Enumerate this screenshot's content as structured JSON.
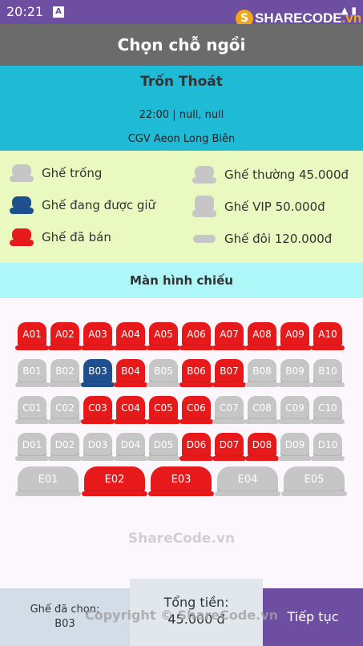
{
  "status": {
    "time": "20:21"
  },
  "logo": {
    "text_a": "SHARECODE",
    "text_b": ".vn"
  },
  "app_bar": {
    "title": "Chọn chỗ ngồi"
  },
  "movie": {
    "title": "Trốn Thoát",
    "time": "22:00 | null, null",
    "cinema": "CGV Aeon Long Biên"
  },
  "legend": {
    "empty": "Ghế trống",
    "held": "Ghế đang được giữ",
    "sold": "Ghế đã bán",
    "regular": "Ghế thường 45.000đ",
    "vip": "Ghế VIP 50.000đ",
    "couple": "Ghế đôi 120.000đ"
  },
  "screen_label": "Màn hình chiếu",
  "colors": {
    "sold": "#e8191a",
    "held": "#1e4f8e",
    "empty": "#c6c6c6",
    "accent": "#6d4ea0"
  },
  "seats": [
    [
      {
        "id": "A01",
        "state": "sold"
      },
      {
        "id": "A02",
        "state": "sold"
      },
      {
        "id": "A03",
        "state": "sold"
      },
      {
        "id": "A04",
        "state": "sold"
      },
      {
        "id": "A05",
        "state": "sold"
      },
      {
        "id": "A06",
        "state": "sold"
      },
      {
        "id": "A07",
        "state": "sold"
      },
      {
        "id": "A08",
        "state": "sold"
      },
      {
        "id": "A09",
        "state": "sold"
      },
      {
        "id": "A10",
        "state": "sold"
      }
    ],
    [
      {
        "id": "B01",
        "state": "empty"
      },
      {
        "id": "B02",
        "state": "empty"
      },
      {
        "id": "B03",
        "state": "held"
      },
      {
        "id": "B04",
        "state": "sold"
      },
      {
        "id": "B05",
        "state": "empty"
      },
      {
        "id": "B06",
        "state": "sold"
      },
      {
        "id": "B07",
        "state": "sold"
      },
      {
        "id": "B08",
        "state": "empty"
      },
      {
        "id": "B09",
        "state": "empty"
      },
      {
        "id": "B10",
        "state": "empty"
      }
    ],
    [
      {
        "id": "C01",
        "state": "empty"
      },
      {
        "id": "C02",
        "state": "empty"
      },
      {
        "id": "C03",
        "state": "sold"
      },
      {
        "id": "C04",
        "state": "sold"
      },
      {
        "id": "C05",
        "state": "sold"
      },
      {
        "id": "C06",
        "state": "sold"
      },
      {
        "id": "C07",
        "state": "empty"
      },
      {
        "id": "C08",
        "state": "empty"
      },
      {
        "id": "C09",
        "state": "empty"
      },
      {
        "id": "C10",
        "state": "empty"
      }
    ],
    [
      {
        "id": "D01",
        "state": "empty"
      },
      {
        "id": "D02",
        "state": "empty"
      },
      {
        "id": "D03",
        "state": "empty"
      },
      {
        "id": "D04",
        "state": "empty"
      },
      {
        "id": "D05",
        "state": "empty"
      },
      {
        "id": "D06",
        "state": "sold"
      },
      {
        "id": "D07",
        "state": "sold"
      },
      {
        "id": "D08",
        "state": "sold"
      },
      {
        "id": "D09",
        "state": "empty"
      },
      {
        "id": "D10",
        "state": "empty"
      }
    ]
  ],
  "couple_seats": [
    {
      "id": "E01",
      "state": "empty"
    },
    {
      "id": "E02",
      "state": "sold"
    },
    {
      "id": "E03",
      "state": "sold"
    },
    {
      "id": "E04",
      "state": "empty"
    },
    {
      "id": "E05",
      "state": "empty"
    }
  ],
  "watermark": "ShareCode.vn",
  "bottom": {
    "chosen_label": "Ghế đã chọn:",
    "chosen_value": "B03",
    "total_label": "Tổng tiền:",
    "total_value": "45.000 đ",
    "next_label": "Tiếp tục"
  },
  "copyright": "Copyright © ShareCode.vn"
}
